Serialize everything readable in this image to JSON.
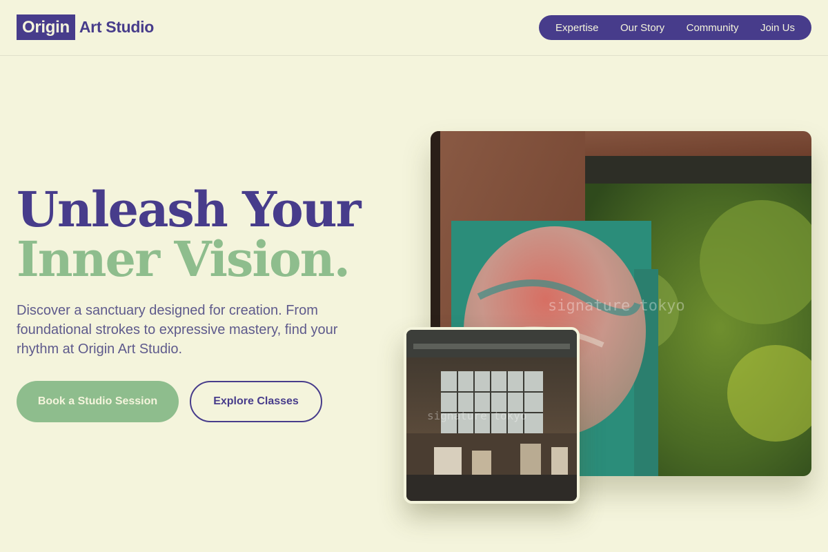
{
  "header": {
    "logo_mark": "Origin",
    "logo_text": "Art Studio",
    "nav": [
      {
        "label": "Expertise"
      },
      {
        "label": "Our Story"
      },
      {
        "label": "Community"
      },
      {
        "label": "Join Us"
      }
    ]
  },
  "hero": {
    "headline_line1": "Unleash Your",
    "headline_line2": "Inner Vision.",
    "lead": "Discover a sanctuary designed for creation. From foundational strokes to expressive mastery, find your rhythm at Origin Art Studio.",
    "primary_button": "Book a Studio Session",
    "secondary_button": "Explore Classes"
  },
  "images": {
    "main_watermark": "signature tokyo",
    "small_watermark": "signature tokyo"
  },
  "colors": {
    "background": "#f4f4dc",
    "brand_purple": "#473c8b",
    "sage_green": "#8ebd8d",
    "body_text": "#5e5a8c"
  }
}
